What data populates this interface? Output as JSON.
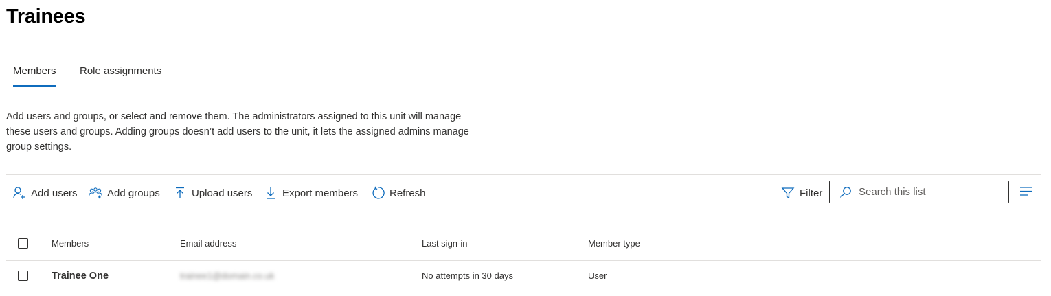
{
  "page": {
    "title": "Trainees"
  },
  "tabs": [
    {
      "label": "Members",
      "active": true
    },
    {
      "label": "Role assignments",
      "active": false
    }
  ],
  "description": "Add users and groups, or select and remove them. The administrators assigned to this unit will manage these users and groups. Adding groups doesn’t add users to the unit, it lets the assigned admins manage group settings.",
  "toolbar": {
    "add_users": "Add users",
    "add_groups": "Add groups",
    "upload_users": "Upload users",
    "export_members": "Export members",
    "refresh": "Refresh",
    "filter": "Filter",
    "search_placeholder": "Search this list",
    "accent_color": "#0f6cbd"
  },
  "table": {
    "columns": [
      "Members",
      "Email address",
      "Last sign-in",
      "Member type"
    ],
    "rows": [
      {
        "name": "Trainee One",
        "email": "trainee1@domain.co.uk",
        "last_sign_in": "No attempts in 30 days",
        "member_type": "User"
      }
    ]
  }
}
